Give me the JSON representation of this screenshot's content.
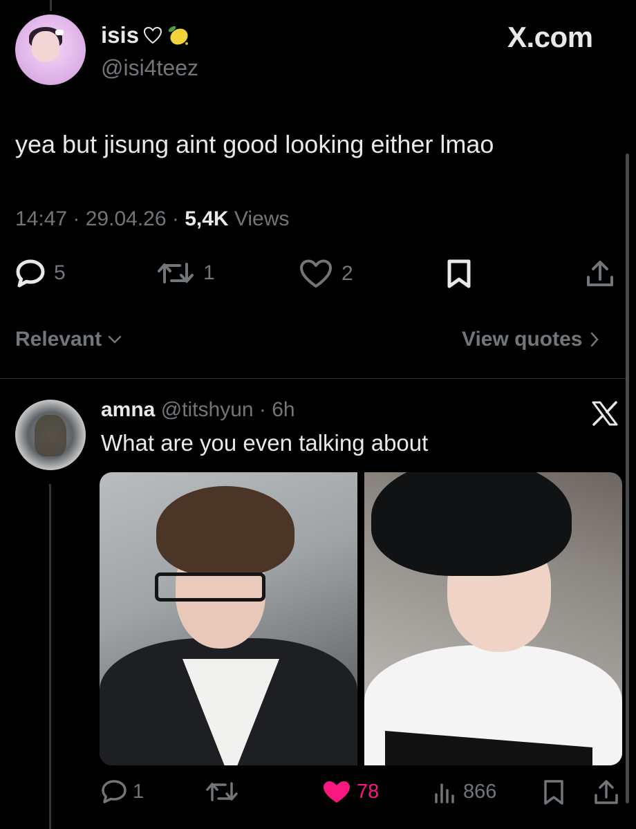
{
  "brand": "X.com",
  "tweet": {
    "display_name": "isis",
    "handle": "@isi4teez",
    "text": "yea but jisung aint good looking either lmao",
    "time": "14:47",
    "date": "29.04.26",
    "views_count": "5,4K",
    "views_label": "Views",
    "replies": "5",
    "reposts": "1",
    "likes": "2"
  },
  "sort": {
    "label": "Relevant"
  },
  "view_quotes": {
    "label": "View quotes"
  },
  "reply": {
    "display_name": "amna",
    "handle": "@titshyun",
    "age": "6h",
    "text": "What are you even talking about",
    "replies": "1",
    "likes": "78",
    "views": "866"
  },
  "colors": {
    "background": "#000000",
    "text": "#e7e9ea",
    "muted": "#71767b",
    "like": "#f91880",
    "divider": "#2f3336"
  },
  "icons": [
    "heart-outline-icon",
    "lemon-icon",
    "reply-icon",
    "repost-icon",
    "like-icon",
    "bookmark-icon",
    "share-icon",
    "chevron-down-icon",
    "chevron-right-icon",
    "x-logo-icon",
    "views-icon"
  ]
}
